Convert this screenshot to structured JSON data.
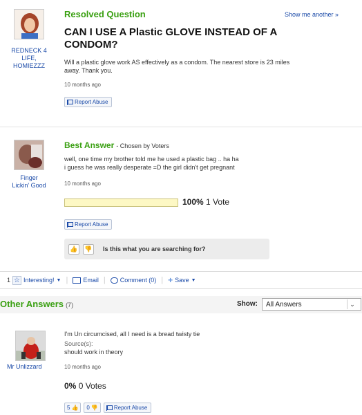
{
  "question": {
    "status": "Resolved Question",
    "show_another": "Show me another »",
    "title_line1": "CAN I USE A Plastic GLOVE INSTEAD OF A",
    "title_line2": "CONDOM?",
    "body_line1": "Will a plastic glove work AS effectively as a condom. The nearest store is 23 miles",
    "body_line2": "away. Thank you.",
    "time": "10 months ago",
    "report": "Report Abuse",
    "asker": {
      "name_line1": "REDNECK 4",
      "name_line2": "LIFE,",
      "name_line3": "HOMIEZZZ"
    }
  },
  "best_answer": {
    "heading": "Best Answer",
    "chosen_by": "- Chosen by Voters",
    "body_line1": "well, one time my brother told me he used a plastic bag .. ha ha",
    "body_line2": "i guess he was really desperate =D the girl didn't get pregnant",
    "time": "10 months ago",
    "vote_percent_label": "100%",
    "vote_count_label": "1 Vote",
    "vote_fraction": 1.0,
    "report": "Report Abuse",
    "search_prompt": "Is this what you are searching for?",
    "answerer": {
      "name_line1": "Finger",
      "name_line2": "Lickin' Good"
    }
  },
  "toolbar": {
    "count": "1",
    "interesting": "Interesting!",
    "email": "Email",
    "comment": "Comment (0)",
    "save": "Save"
  },
  "other_answers": {
    "heading": "Other Answers",
    "count": "(7)",
    "show_label": "Show:",
    "show_selected": "All Answers",
    "answer": {
      "body": "I'm Un circumcised, all I need is a bread twisty tie",
      "sources_label": "Source(s):",
      "sources": "should work in theory",
      "time": "10 months ago",
      "vote_percent_label": "0%",
      "vote_count_label": "0 Votes",
      "thumbs_up_count": "5",
      "thumbs_down_count": "0",
      "report": "Report Abuse",
      "answerer": {
        "name": "Mr Unlizzard"
      }
    }
  },
  "colors": {
    "green": "#3aa012",
    "link": "#1a4aa8",
    "vote_bar": "#fdf8c4"
  },
  "icons": [
    "star-icon",
    "email-icon",
    "comment-icon",
    "plus-icon",
    "thumbs-up-icon",
    "thumbs-down-icon",
    "flag-icon",
    "chevron-down-icon"
  ]
}
